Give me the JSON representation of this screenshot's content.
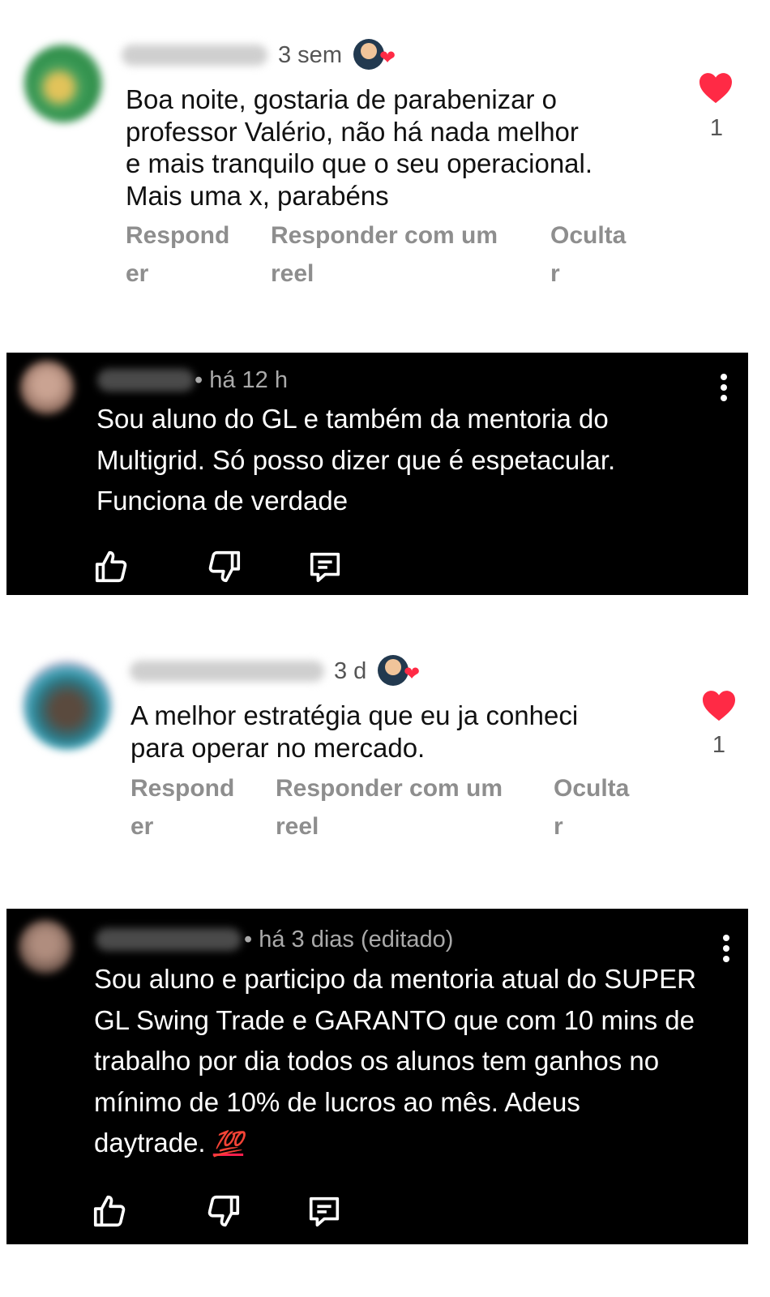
{
  "comments": [
    {
      "platform": "instagram",
      "time": "3 sem",
      "text": "Boa noite,  gostaria de  parabenizar o\nprofessor  Valério,  não  há  nada  melhor\ne mais  tranquilo que o seu operacional.\nMais uma  x, parabéns",
      "actions": {
        "reply": "Respond\ner",
        "reply_reel": "Responder com um\nreel",
        "hide": "Oculta\nr"
      },
      "likes": "1"
    },
    {
      "platform": "youtube",
      "meta": "• há 12 h",
      "text": "Sou aluno do GL e também da mentoria do\nMultigrid. Só posso dizer que é espetacular.\nFunciona de verdade"
    },
    {
      "platform": "instagram",
      "time": "3 d",
      "text": "A melhor estratégia que eu ja conheci\npara operar no mercado.",
      "actions": {
        "reply": "Respond\ner",
        "reply_reel": "Responder com um\nreel",
        "hide": "Oculta\nr"
      },
      "likes": "1"
    },
    {
      "platform": "youtube",
      "meta": "• há 3 dias (editado)",
      "text": "Sou aluno e participo da mentoria atual do SUPER\nGL Swing Trade e GARANTO que  com 10 mins de\ntrabalho por dia todos os alunos tem ganhos no\nmínimo de 10% de lucros ao mês. Adeus\ndaytrade.",
      "emoji": "💯"
    }
  ],
  "icons": {
    "like_heart": "heart-icon",
    "thumbs_up": "thumbs-up-icon",
    "thumbs_down": "thumbs-down-icon",
    "reply": "reply-icon",
    "menu": "more-vert-icon"
  },
  "colors": {
    "heart": "#ff2a45",
    "dark_bg": "#000000",
    "action_gray": "#8e8e8e"
  }
}
